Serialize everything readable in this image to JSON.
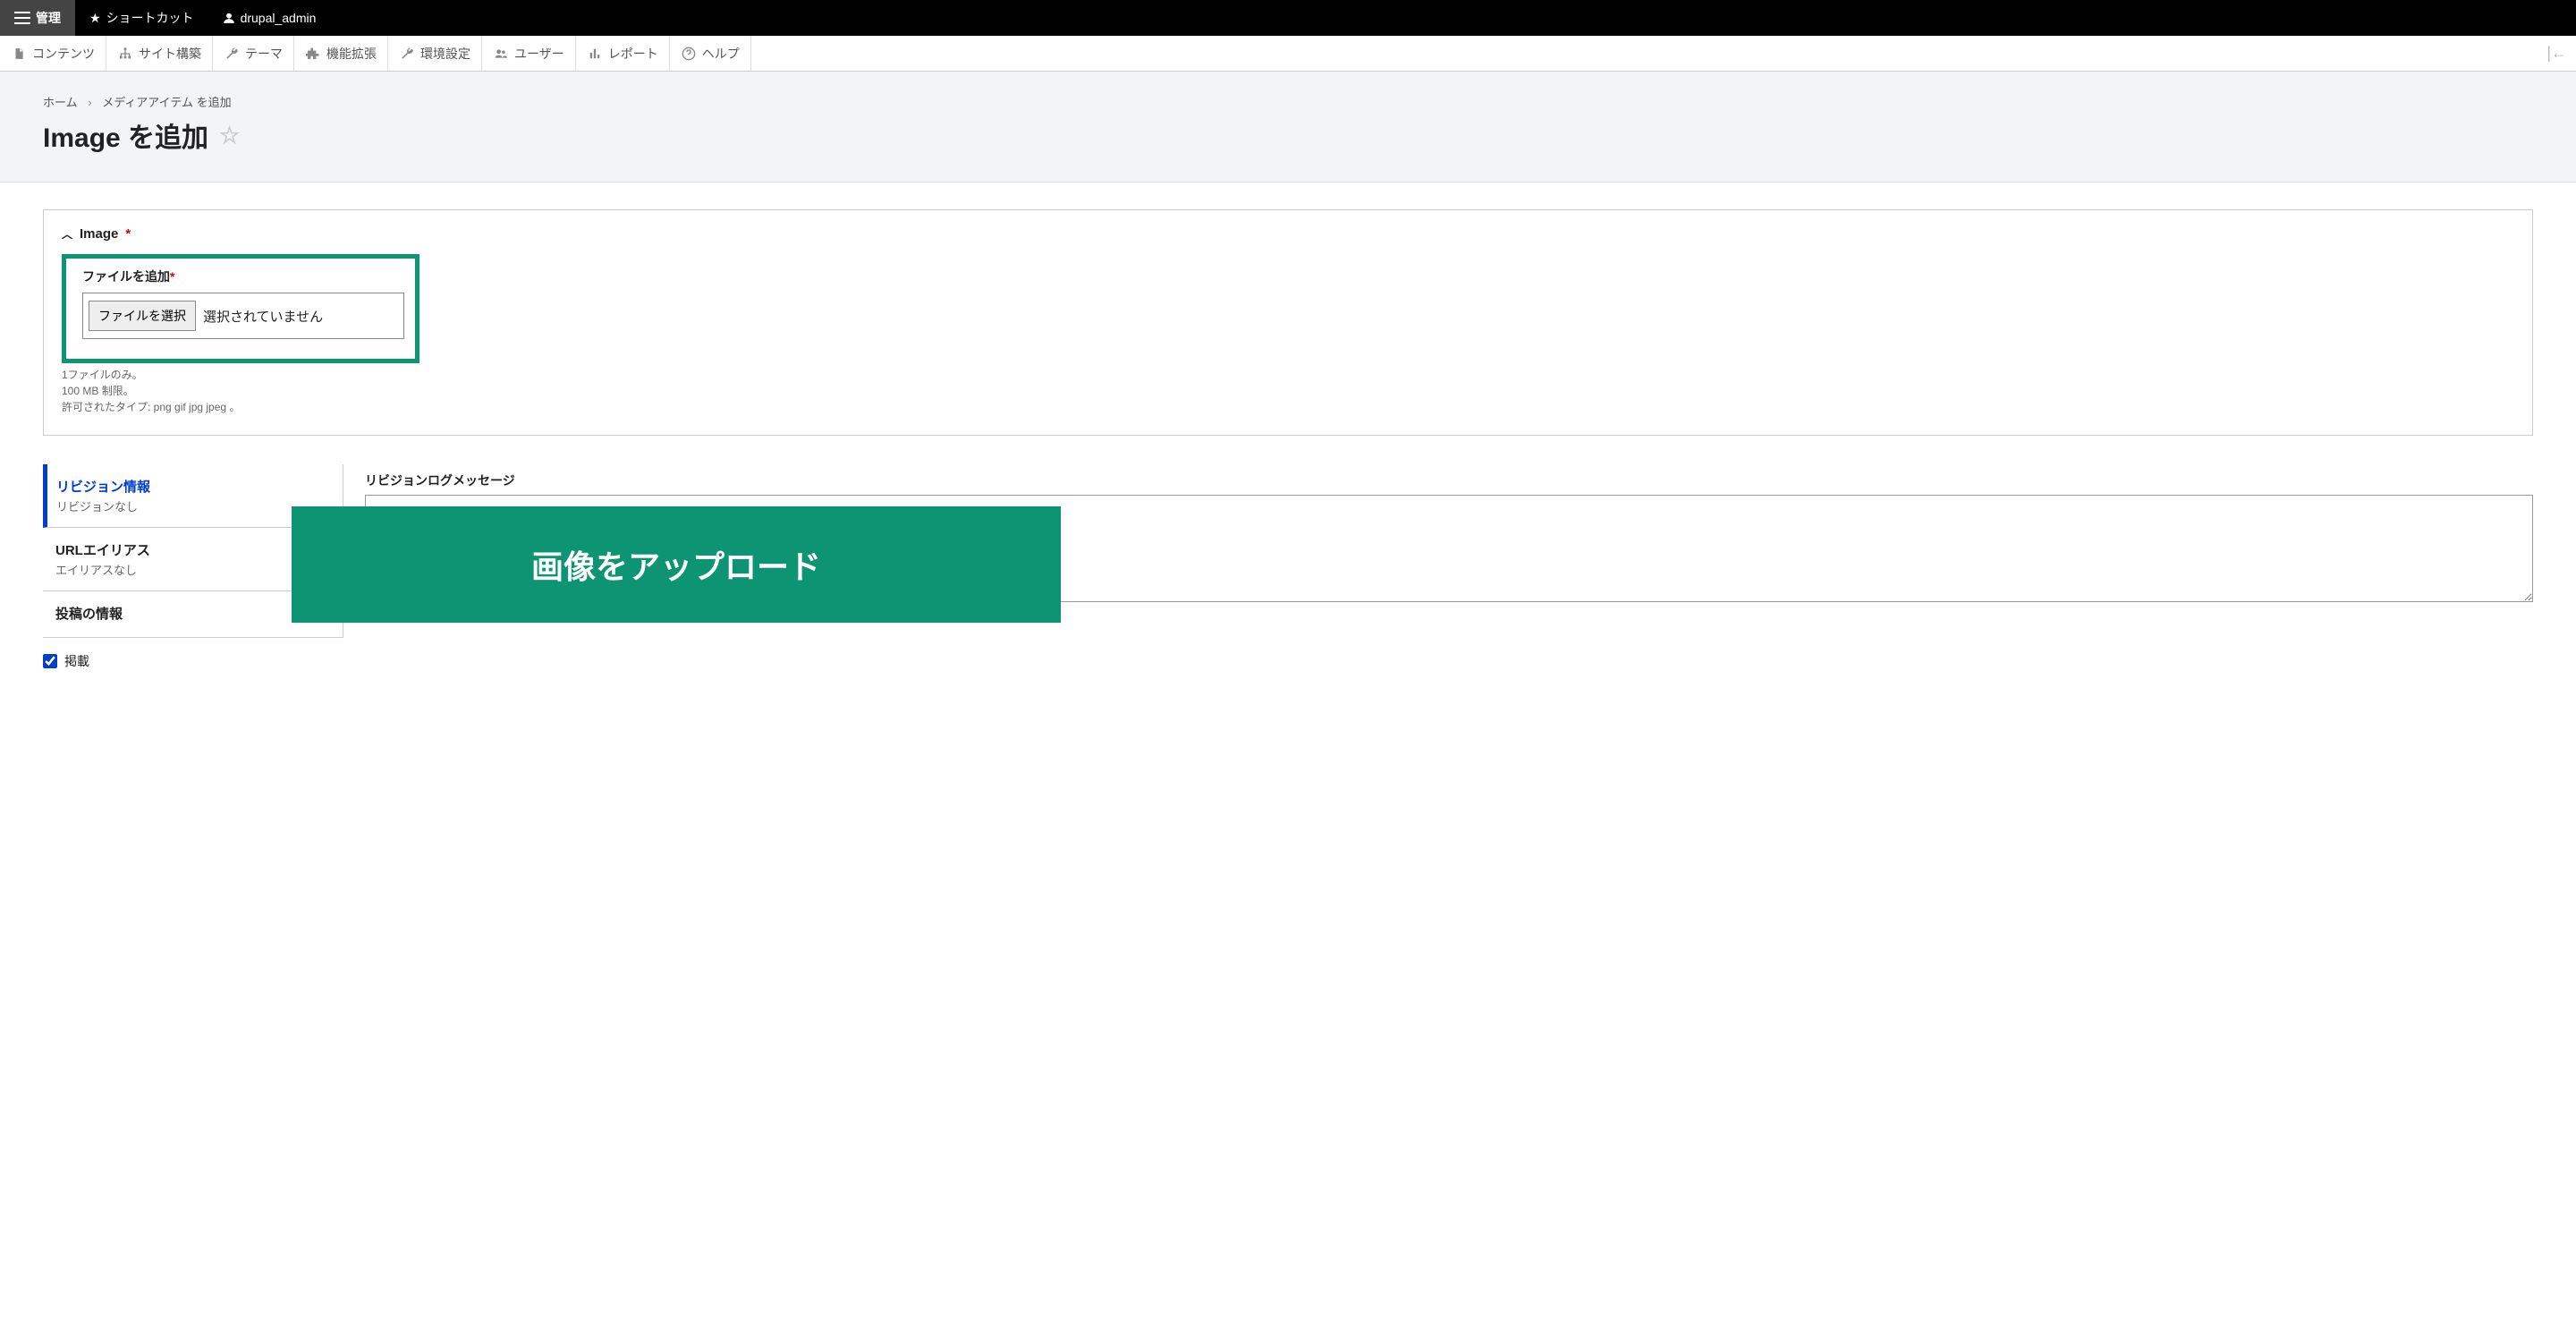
{
  "toolbar": {
    "manage": "管理",
    "shortcuts": "ショートカット",
    "user": "drupal_admin"
  },
  "menu": {
    "content": "コンテンツ",
    "structure": "サイト構築",
    "appearance": "テーマ",
    "extend": "機能拡張",
    "config": "環境設定",
    "people": "ユーザー",
    "reports": "レポート",
    "help": "ヘルプ"
  },
  "breadcrumb": {
    "home": "ホーム",
    "add_media": "メディアアイテム を追加"
  },
  "page_title": "Image を追加",
  "image_panel": {
    "title": "Image",
    "add_file_label": "ファイルを追加",
    "choose_button": "ファイルを選択",
    "no_file": "選択されていません",
    "hint1": "1ファイルのみ。",
    "hint2": "100 MB 制限。",
    "hint3": "許可されたタイプ: png gif jpg jpeg 。"
  },
  "tabs": {
    "revision": {
      "title": "リビジョン情報",
      "sub": "リビジョンなし"
    },
    "url": {
      "title": "URLエイリアス",
      "sub": "エイリアスなし"
    },
    "author": {
      "title": "投稿の情報",
      "sub": ""
    }
  },
  "revision": {
    "label": "リビジョンログメッセージ"
  },
  "overlay": "画像をアップロード",
  "published": "掲載"
}
